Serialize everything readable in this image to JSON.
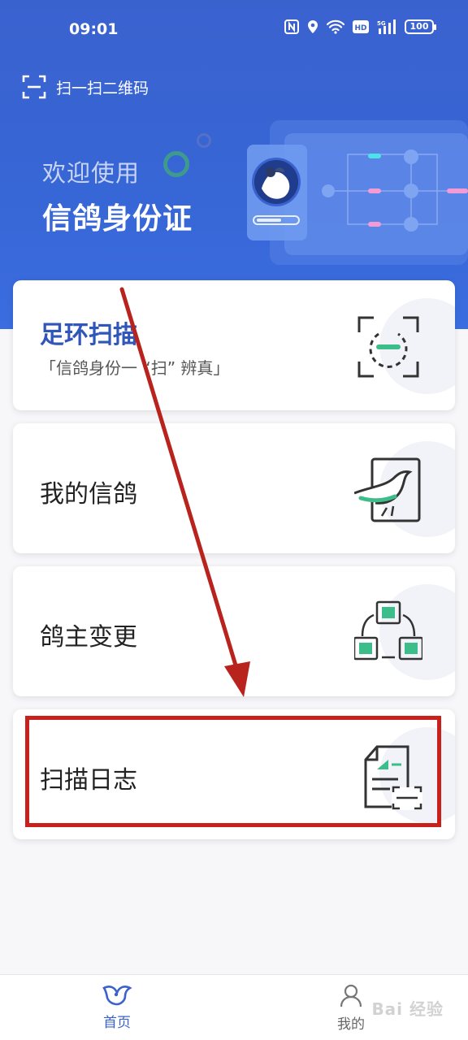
{
  "status_bar": {
    "time": "09:01",
    "battery": "100",
    "network": "5G",
    "hd": "HD"
  },
  "header": {
    "scan_qr_label": "扫一扫二维码",
    "welcome_line1": "欢迎使用",
    "welcome_line2": "信鸽身份证"
  },
  "cards": [
    {
      "title": "足环扫描",
      "subtitle": "「信鸽身份一 “扫” 辨真」",
      "icon": "scan-icon"
    },
    {
      "title": "我的信鸽",
      "icon": "pigeon-icon"
    },
    {
      "title": "鸽主变更",
      "icon": "owner-change-icon"
    },
    {
      "title": "扫描日志",
      "icon": "scan-log-icon"
    }
  ],
  "bottom_nav": [
    {
      "label": "首页",
      "icon": "home-pigeon-icon",
      "active": true
    },
    {
      "label": "我的",
      "icon": "user-icon",
      "active": false
    }
  ],
  "watermark": "Bai 经验",
  "colors": {
    "primary": "#3a62cf",
    "accent_green": "#3dbd8a",
    "annotation_red": "#c8201b"
  }
}
